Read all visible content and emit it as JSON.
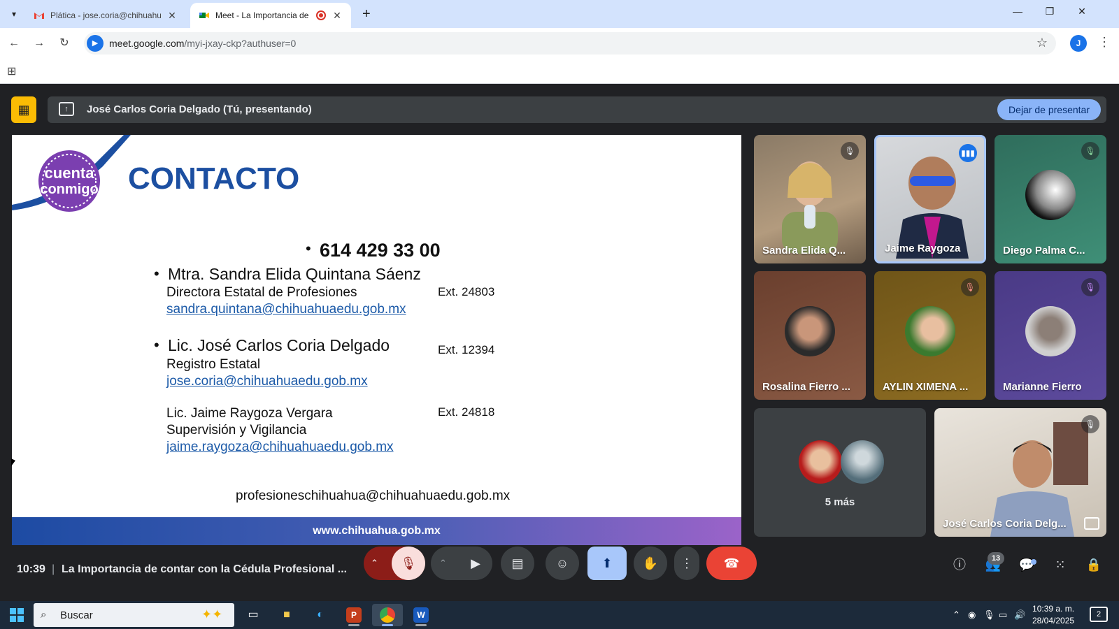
{
  "browser": {
    "tabs": [
      {
        "title": "Plática - jose.coria@chihuahuaedu.gob.mx",
        "icon": "gmail-icon"
      },
      {
        "title": "Meet - La Importancia de contar con la Cédula",
        "icon": "meet-icon"
      }
    ],
    "url_domain": "meet.google.com",
    "url_path": "/myi-jxay-ckp?authuser=0",
    "profile_initial": "J"
  },
  "presenting": {
    "text": "José Carlos Coria Delgado (Tú, presentando)",
    "stop_label": "Dejar de presentar"
  },
  "slide": {
    "logo_text": "cuenta conmigo",
    "title": "CONTACTO",
    "phone": "614 429 33 00",
    "c1_name": "Mtra. Sandra Elida Quintana Sáenz",
    "c1_role": "Directora Estatal de Profesiones",
    "c1_ext": "Ext. 24803",
    "c1_email": "sandra.quintana@chihuahuaedu.gob.mx",
    "c2_name": "Lic. José Carlos Coria Delgado",
    "c2_ext": "Ext.  12394",
    "c2_role": "Registro Estatal",
    "c2_email": "jose.coria@chihuahuaedu.gob.mx",
    "c3_name": "Lic. Jaime Raygoza Vergara",
    "c3_ext": "Ext.  24818",
    "c3_role": "Supervisión y Vigilancia",
    "c3_email": "jaime.raygoza@chihuahuaedu.gob.mx",
    "general_email": "profesioneschihuahua@chihuahuaedu.gob.mx",
    "footer": "www.chihuahua.gob.mx"
  },
  "participants": {
    "p1": "Sandra Elida Q...",
    "p2": "Jaime Raygoza",
    "p3": "Diego Palma C...",
    "p4": "Rosalina Fierro ...",
    "p5": "AYLIN XIMENA ...",
    "p6": "Marianne Fierro",
    "more": "5 más",
    "self": "José Carlos Coria Delg..."
  },
  "bottom": {
    "time": "10:39",
    "separator": "|",
    "meeting_title": "La Importancia de contar con la Cédula Profesional ...",
    "people_count": "13"
  },
  "taskbar": {
    "search_placeholder": "Buscar",
    "time": "10:39 a. m.",
    "date": "28/04/2025",
    "notifications": "2"
  },
  "colors": {
    "meet_bg": "#202124",
    "accent_blue": "#a8c7fa",
    "end_call": "#ea4335",
    "slide_title": "#1c4fa1"
  }
}
